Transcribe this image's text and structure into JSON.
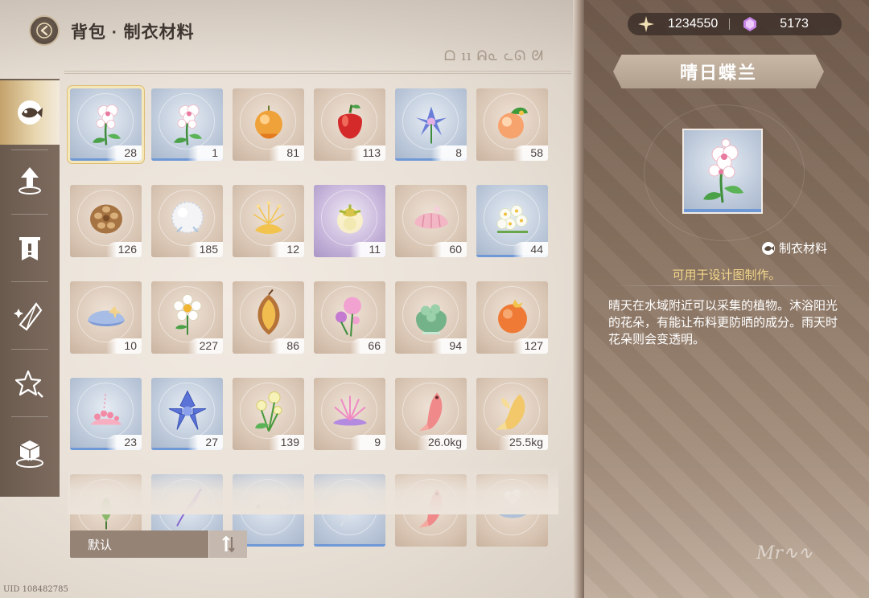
{
  "header": {
    "title": "背包 · 制衣材料",
    "deco_glyphs": "ᗝ ıı ᕱᓇ ᓚᘏ ᘛ"
  },
  "sidebar": {
    "items": [
      {
        "icon": "fish-icon",
        "active": true
      },
      {
        "icon": "upgrade-arrow-icon",
        "active": false
      },
      {
        "icon": "quest-banner-icon",
        "active": false
      },
      {
        "icon": "crystal-shard-icon",
        "active": false
      },
      {
        "icon": "sparkle-icon",
        "active": false
      },
      {
        "icon": "box-icon",
        "active": false
      }
    ]
  },
  "currency": {
    "stellar": "1234550",
    "diamond": "5173"
  },
  "inventory": {
    "items": [
      {
        "icon": "white-orchid-icon",
        "qty": "28",
        "bg": "blue",
        "selected": true
      },
      {
        "icon": "white-orchid-icon",
        "qty": "1",
        "bg": "blue"
      },
      {
        "icon": "orange-fruit-icon",
        "qty": "81",
        "bg": "tan"
      },
      {
        "icon": "red-bell-fruit-icon",
        "qty": "113",
        "bg": "tan"
      },
      {
        "icon": "blue-star-flower-icon",
        "qty": "8",
        "bg": "blue"
      },
      {
        "icon": "peach-fruit-icon",
        "qty": "58",
        "bg": "tan"
      },
      {
        "icon": "pinecone-icon",
        "qty": "126",
        "bg": "tan"
      },
      {
        "icon": "fluffy-ball-icon",
        "qty": "185",
        "bg": "tan"
      },
      {
        "icon": "golden-sparkle-icon",
        "qty": "12",
        "bg": "tan"
      },
      {
        "icon": "glowing-bud-icon",
        "qty": "11",
        "bg": "purple"
      },
      {
        "icon": "pink-shell-icon",
        "qty": "60",
        "bg": "tan"
      },
      {
        "icon": "white-blossom-cluster-icon",
        "qty": "44",
        "bg": "blue"
      },
      {
        "icon": "blue-clam-icon",
        "qty": "10",
        "bg": "tan"
      },
      {
        "icon": "white-daisy-icon",
        "qty": "227",
        "bg": "tan"
      },
      {
        "icon": "brown-seed-icon",
        "qty": "86",
        "bg": "tan"
      },
      {
        "icon": "pink-ball-flower-icon",
        "qty": "66",
        "bg": "tan"
      },
      {
        "icon": "green-cabbage-icon",
        "qty": "94",
        "bg": "tan"
      },
      {
        "icon": "orange-star-fruit-icon",
        "qty": "127",
        "bg": "tan"
      },
      {
        "icon": "pink-coral-icon",
        "qty": "23",
        "bg": "blue"
      },
      {
        "icon": "blue-bell-flower-icon",
        "qty": "27",
        "bg": "blue"
      },
      {
        "icon": "yellow-tulip-icon",
        "qty": "139",
        "bg": "tan"
      },
      {
        "icon": "pink-anemone-icon",
        "qty": "9",
        "bg": "tan"
      },
      {
        "icon": "pink-fish-icon",
        "qty": "26.0kg",
        "bg": "tan"
      },
      {
        "icon": "golden-fish-icon",
        "qty": "25.5kg",
        "bg": "tan"
      },
      {
        "icon": "leaf-sprout-icon",
        "qty": "",
        "bg": "tan"
      },
      {
        "icon": "purple-feather-icon",
        "qty": "",
        "bg": "blue"
      },
      {
        "icon": "silver-fish-icon",
        "qty": "",
        "bg": "blue"
      },
      {
        "icon": "white-feather-icon",
        "qty": "",
        "bg": "blue"
      },
      {
        "icon": "pink-fish-icon",
        "qty": "",
        "bg": "tan"
      },
      {
        "icon": "white-lily-fish-icon",
        "qty": "",
        "bg": "tan"
      }
    ]
  },
  "sort": {
    "label": "默认"
  },
  "uid": "UID 108482785",
  "detail": {
    "name": "晴日蝶兰",
    "category": "制衣材料",
    "usage": "可用于设计图制作。",
    "description": "晴天在水域附近可以采集的植物。沐浴阳光的花朵，有能让布料更防晒的成分。雨天时花朵则会变透明。"
  },
  "colors": {
    "accent_gold": "#f4d88a",
    "selected_outline": "#dcbc76",
    "rarity_blue": "#6f98d6"
  }
}
